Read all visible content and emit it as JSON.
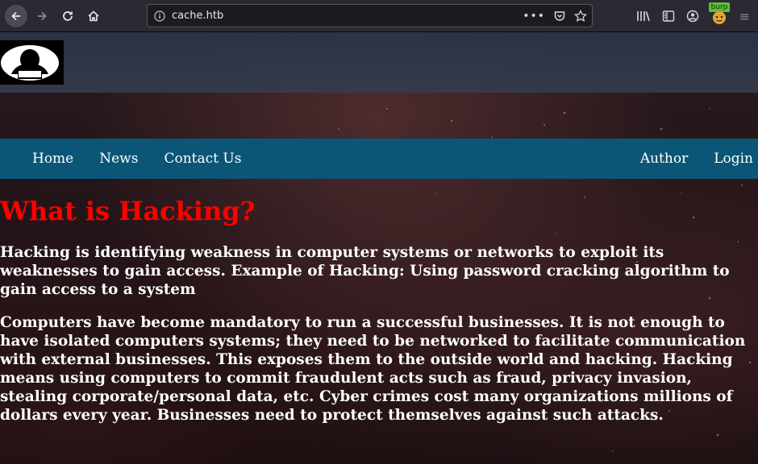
{
  "browser": {
    "url": "cache.htb",
    "burp_badge": "burp",
    "icons": [
      "back-arrow-icon",
      "forward-arrow-icon",
      "reload-icon",
      "home-icon",
      "info-icon",
      "more-icon",
      "pocket-icon",
      "star-icon",
      "library-icon",
      "sidebar-icon",
      "account-icon",
      "burp-extension-icon",
      "overflow-icon"
    ]
  },
  "site": {
    "nav_left": [
      {
        "label": "Home"
      },
      {
        "label": "News"
      },
      {
        "label": "Contact Us"
      }
    ],
    "nav_right": [
      {
        "label": "Author"
      },
      {
        "label": "Login"
      }
    ],
    "title": "What is Hacking?",
    "paragraphs": [
      "Hacking is identifying weakness in computer systems or networks to exploit its weaknesses to gain access. Example of Hacking: Using password cracking algorithm to gain access to a system",
      "Computers have become mandatory to run a successful businesses. It is not enough to have isolated computers systems; they need to be networked to facilitate communication with external businesses. This exposes them to the outside world and hacking. Hacking means using computers to commit fraudulent acts such as fraud, privacy invasion, stealing corporate/personal data, etc. Cyber crimes cost many organizations millions of dollars every year. Businesses need to protect themselves against such attacks."
    ]
  },
  "colors": {
    "navbar": "#0b5677",
    "title": "#ff0000",
    "text": "#ffffff"
  }
}
